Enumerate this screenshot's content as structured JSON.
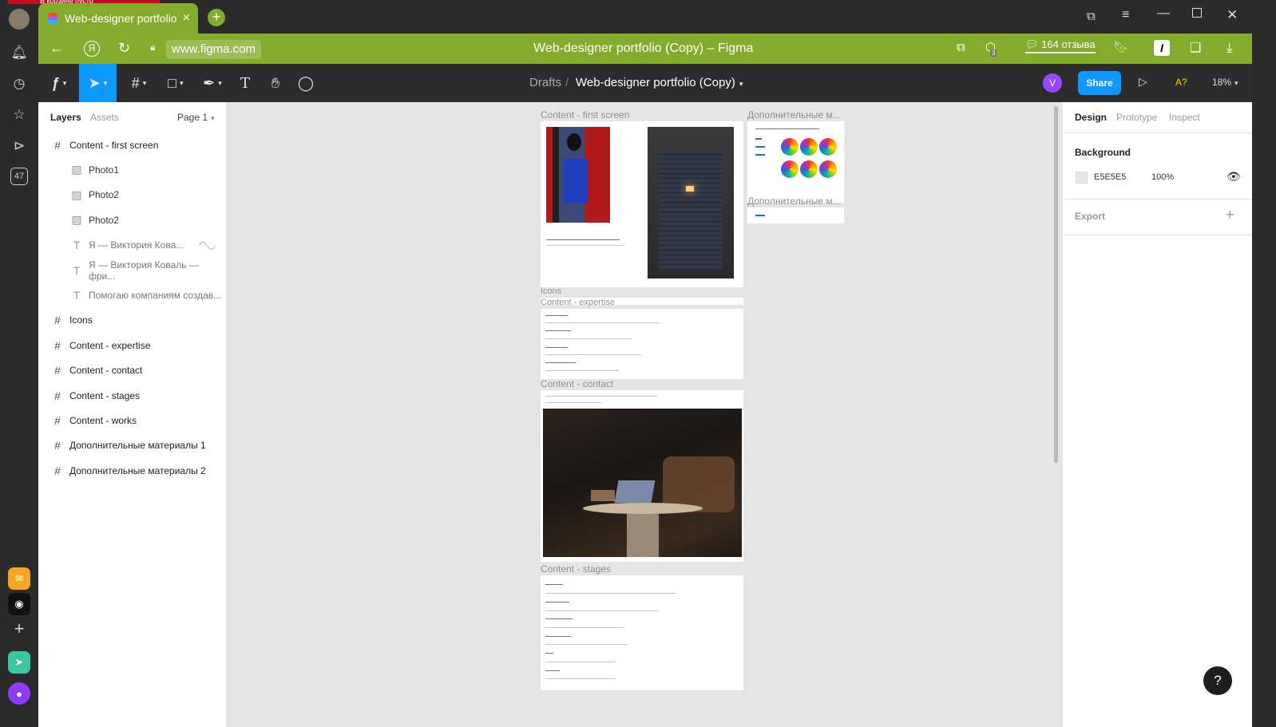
{
  "browser": {
    "tab_title": "Web-designer portfolio",
    "tab_close": "×",
    "address": "www.figma.com",
    "page_title": "Web-designer portfolio (Copy) – Figma",
    "reviews": "164 отзыва",
    "side_count": "47",
    "ad_strip": "В корзине пусто",
    "badge": "3"
  },
  "toolbar": {
    "breadcrumb_root": "Drafts",
    "breadcrumb_sep": "/",
    "file_name": "Web-designer portfolio (Copy)",
    "avatar": "V",
    "share": "Share",
    "font_check": "A?",
    "zoom": "18%"
  },
  "left_panel": {
    "tabs": [
      "Layers",
      "Assets"
    ],
    "page": "Page 1",
    "layers": [
      {
        "label": "Content - first screen",
        "type": "frame"
      },
      {
        "label": "Photo1",
        "type": "image"
      },
      {
        "label": "Photo2",
        "type": "image"
      },
      {
        "label": "Photo2",
        "type": "image"
      },
      {
        "label": "Я — Виктория Кова...",
        "type": "text"
      },
      {
        "label": "Я — Виктория Коваль — фри...",
        "type": "text"
      },
      {
        "label": "Помогаю компаниям создав...",
        "type": "text"
      },
      {
        "label": "Icons",
        "type": "frame"
      },
      {
        "label": "Content - expertise",
        "type": "frame"
      },
      {
        "label": "Content - contact",
        "type": "frame"
      },
      {
        "label": "Content - stages",
        "type": "frame"
      },
      {
        "label": "Content - works",
        "type": "frame"
      },
      {
        "label": "Дополнительные материалы 1",
        "type": "frame"
      },
      {
        "label": "Дополнительные материалы 2",
        "type": "frame"
      }
    ]
  },
  "canvas": {
    "frames": {
      "first_screen": "Content - first screen",
      "icons": "Icons",
      "expertise": "Content - expertise",
      "contact": "Content - contact",
      "stages": "Content - stages",
      "extra1": "Дополнительные м...",
      "extra2": "Дополнительные м..."
    }
  },
  "right_panel": {
    "tabs": [
      "Design",
      "Prototype",
      "Inspect"
    ],
    "background_label": "Background",
    "bg_hex": "E5E5E5",
    "bg_opacity": "100%",
    "export_label": "Export"
  },
  "help": "?",
  "colors": {
    "browser_accent": "#84ac2c",
    "figma_blue": "#0d99ff",
    "dark": "#2c2c2c",
    "canvas_bg": "#e5e5e5",
    "avatar_purple": "#9747ff"
  }
}
